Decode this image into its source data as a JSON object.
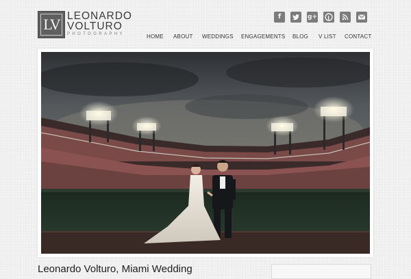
{
  "logo": {
    "monogram": "LV",
    "name_line1": "LEONARDO",
    "name_line2": "VOLTURO",
    "tagline": "PHOTOGRAPHY"
  },
  "social": [
    {
      "name": "facebook-icon",
      "glyph": "f"
    },
    {
      "name": "twitter-icon",
      "glyph": ""
    },
    {
      "name": "google-plus-icon",
      "glyph": "g+"
    },
    {
      "name": "pinterest-icon",
      "glyph": "P"
    },
    {
      "name": "rss-icon",
      "glyph": ""
    },
    {
      "name": "email-icon",
      "glyph": ""
    }
  ],
  "nav": {
    "items": [
      "HOME",
      "ABOUT",
      "WEDDINGS",
      "ENGAGEMENTS",
      "BLOG",
      "V LIST",
      "CONTACT"
    ]
  },
  "hero": {
    "subject": "Bride and groom standing on a baseball stadium field at dusk under stadium lights"
  },
  "post": {
    "title": "Leonardo Volturo, Miami Wedding"
  },
  "colors": {
    "background": "#f1f1f1",
    "icon_gray": "#7b7b7b",
    "logo_gray": "#5f5f5f",
    "text_dark": "#222222"
  }
}
